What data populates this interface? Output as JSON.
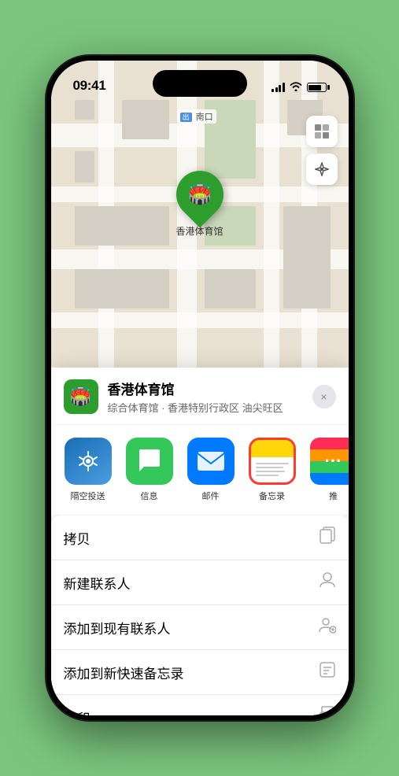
{
  "phone": {
    "time": "09:41",
    "location": "香港体育馆",
    "subtitle": "综合体育馆 · 香港特别行政区 油尖旺区",
    "map_label": "南口",
    "pin_emoji": "🏟️"
  },
  "share_actions": [
    {
      "id": "airdrop",
      "label": "隔空投送",
      "type": "airdrop"
    },
    {
      "id": "message",
      "label": "信息",
      "type": "message"
    },
    {
      "id": "mail",
      "label": "邮件",
      "type": "mail"
    },
    {
      "id": "notes",
      "label": "备忘录",
      "type": "notes",
      "selected": true
    },
    {
      "id": "more",
      "label": "推",
      "type": "more"
    }
  ],
  "menu_items": [
    {
      "id": "copy",
      "label": "拷贝",
      "icon": "📋"
    },
    {
      "id": "new-contact",
      "label": "新建联系人",
      "icon": "👤"
    },
    {
      "id": "add-contact",
      "label": "添加到现有联系人",
      "icon": "👤+"
    },
    {
      "id": "quick-note",
      "label": "添加到新快速备忘录",
      "icon": "📝"
    },
    {
      "id": "print",
      "label": "打印",
      "icon": "🖨️"
    }
  ],
  "close_label": "×"
}
